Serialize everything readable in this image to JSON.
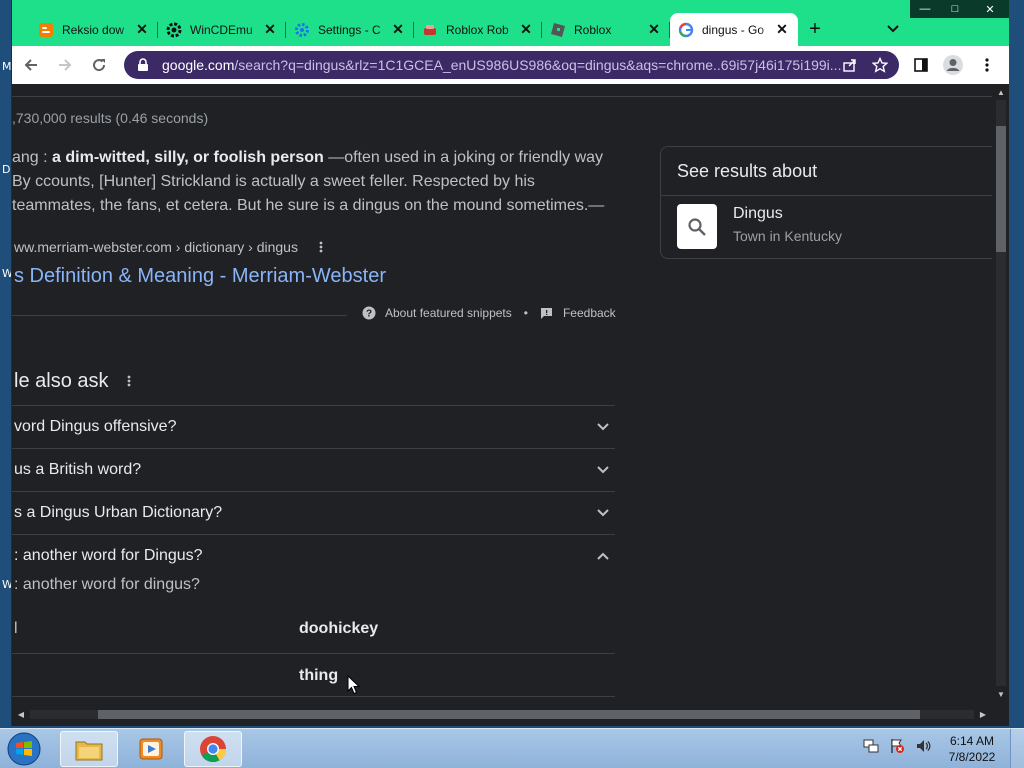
{
  "desktop": {
    "left_glyphs": [
      "M",
      "D",
      "W",
      "W"
    ]
  },
  "window": {
    "minimize_glyph": "—",
    "maximize_glyph": "□",
    "close_glyph": "✕"
  },
  "tabs": [
    {
      "title": "Reksio dow",
      "favicon": "blogger-icon",
      "favicon_color": "#f57d00",
      "close": "✕"
    },
    {
      "title": "WinCDEmu",
      "favicon": "gear-icon",
      "favicon_color": "#111111",
      "close": "✕"
    },
    {
      "title": "Settings - C",
      "favicon": "settings-gear-icon",
      "favicon_color": "#1a73e8",
      "close": "✕"
    },
    {
      "title": "Roblox Rob",
      "favicon": "roblox-icon",
      "favicon_color": "#c0392b",
      "close": "✕"
    },
    {
      "title": "Roblox",
      "favicon": "roblox-icon",
      "favicon_color": "#555555",
      "close": "✕"
    },
    {
      "title": "dingus - Go",
      "favicon": "google-icon",
      "favicon_color": "#4285f4",
      "close": "✕",
      "active": true
    }
  ],
  "new_tab_label": "+",
  "address_bar": {
    "host": "google.com",
    "path": "/search?q=dingus&rlz=1C1GCEA_enUS986US986&oq=dingus&aqs=chrome..69i57j46i175i199i..."
  },
  "search": {
    "result_stats": ",730,000 results (0.46 seconds)",
    "snippet": {
      "lead": "ang : ",
      "bold": "a dim-witted, silly, or foolish person",
      "rest": " —often used in a joking or friendly way By ccounts, [Hunter] Strickland is actually a sweet feller. Respected by his teammates, the fans, et cetera. But he sure is a dingus on the mound sometimes.—"
    },
    "cite": "ww.merriam-webster.com › dictionary › dingus",
    "result_link": "s Definition & Meaning - Merriam-Webster",
    "about_snippets": "About featured snippets",
    "feedback": "Feedback",
    "paa_title": "le also ask",
    "paa_questions": [
      {
        "q": "vord Dingus offensive?",
        "expanded": false
      },
      {
        "q": "us a British word?",
        "expanded": false
      },
      {
        "q": "s a Dingus Urban Dictionary?",
        "expanded": false
      },
      {
        "q": ": another word for Dingus?",
        "expanded": true
      }
    ],
    "paa_sub_question": ": another word for dingus?",
    "synonyms": [
      {
        "left": "l",
        "right": "doohickey"
      },
      {
        "left": "",
        "right": "thing"
      }
    ],
    "knowledge_panel": {
      "title": "See results about",
      "name": "Dingus",
      "description": "Town in Kentucky"
    }
  },
  "taskbar": {
    "time": "6:14 AM",
    "date": "7/8/2022",
    "apps": [
      "file-explorer-icon",
      "media-player-icon",
      "chrome-icon"
    ]
  },
  "colors": {
    "title_bar": "#1fe08a",
    "omnibox": "#3c2a66",
    "page_bg": "#202124",
    "link": "#8ab4f8"
  }
}
